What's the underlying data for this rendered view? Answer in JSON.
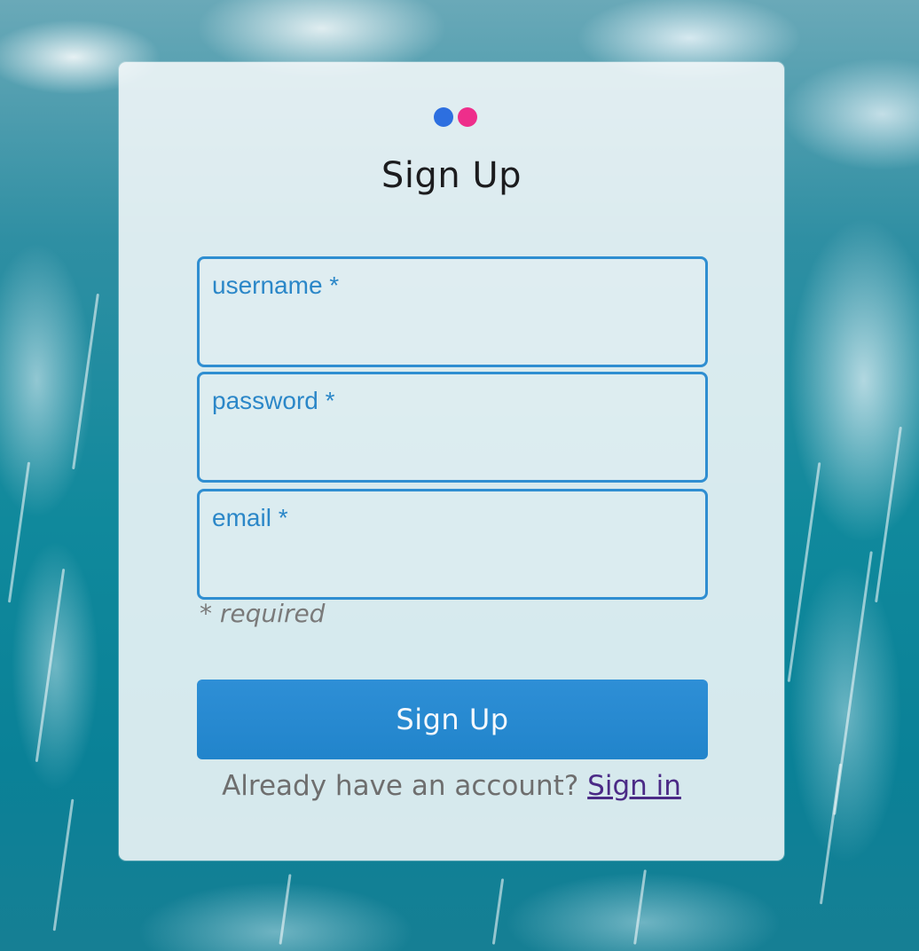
{
  "colors": {
    "logo_blue": "#2d6fe0",
    "logo_pink": "#ee2e8b",
    "accent": "#2f8ed1",
    "button_bg": "#2587ce",
    "link": "#4b2a86"
  },
  "logo": {
    "icon": "two-dot-logo-icon"
  },
  "form": {
    "title": "Sign Up",
    "fields": [
      {
        "label": "username *",
        "value": "",
        "type": "text"
      },
      {
        "label": "password *",
        "value": "",
        "type": "password"
      },
      {
        "label": "email *",
        "value": "",
        "type": "email"
      }
    ],
    "required_note": "* required",
    "submit_label": "Sign Up"
  },
  "footer": {
    "prompt": "Already have an account?",
    "link_label": "Sign in"
  }
}
